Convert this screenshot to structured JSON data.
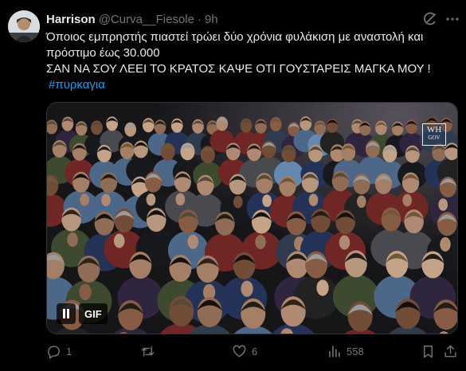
{
  "tweet": {
    "author_name": "Harrison",
    "author_handle": "@Curva__Fiesole",
    "separator": "·",
    "time": "9h",
    "text_lines": [
      "Όποιος εμπρηστής πιαστεί τρώει δύο χρόνια φυλάκιση με αναστολή και",
      "πρόστιμο έως 30.000",
      "ΣΑΝ ΝΑ ΣΟΥ ΛΕΕΙ ΤΟ ΚΡΑΤΟΣ ΚΑΨΕ ΟΤΙ ΓΟΥΣΤΑΡΕΙΣ ΜΑΓΚΑ ΜΟΥ !"
    ],
    "hashtag": "#πυρκαγια"
  },
  "media": {
    "type": "gif",
    "gif_label": "GIF",
    "watermark_line1": "WH",
    "watermark_line2": "GOV"
  },
  "actions": {
    "reply_count": "1",
    "repost_count": "",
    "like_count": "6",
    "view_count": "558"
  },
  "colors": {
    "background": "#000000",
    "text": "#e7e9ea",
    "muted": "#71767b",
    "link": "#1d9bf0"
  },
  "icons": [
    "grok-icon",
    "more-icon",
    "pause-icon",
    "reply-icon",
    "repost-icon",
    "like-icon",
    "views-icon",
    "bookmark-icon",
    "share-icon"
  ]
}
